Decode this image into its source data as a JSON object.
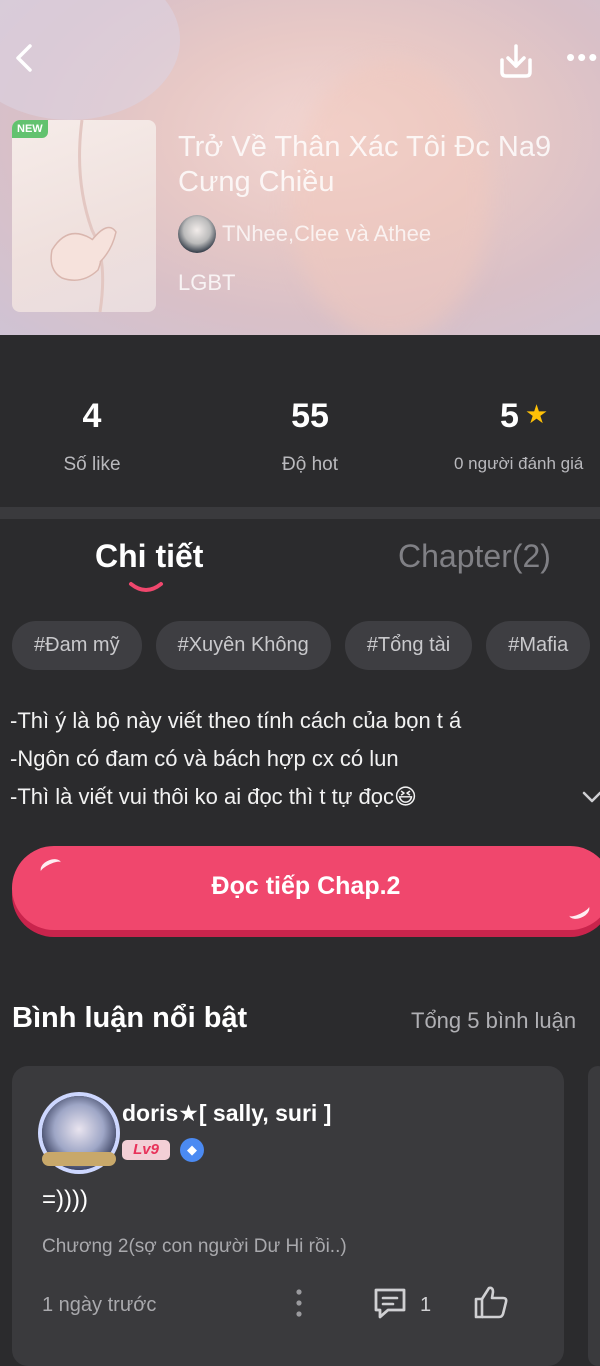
{
  "header": {
    "badge": "NEW",
    "title": "Trở Về Thân Xác Tôi Đc Na9 Cưng Chiều",
    "authors": "TNhee,Clee và Athee",
    "genre": "LGBT"
  },
  "stats": [
    {
      "value": "4",
      "label": "Số like"
    },
    {
      "value": "55",
      "label": "Độ hot"
    },
    {
      "value": "5",
      "label": "0 người đánh giá"
    }
  ],
  "tabs": [
    {
      "label": "Chi tiết",
      "active": true
    },
    {
      "label": "Chapter(2)",
      "active": false
    }
  ],
  "tags": [
    "#Đam mỹ",
    "#Xuyên Không",
    "#Tổng tài",
    "#Mafia"
  ],
  "description": [
    "-Thì ý là bộ này viết theo tính cách của bọn t á",
    "-Ngôn có đam có và bách hợp cx có lun",
    "-Thì là viết vui thôi ko ai đọc thì t tự đọc😆"
  ],
  "read_button": "Đọc tiếp Chap.2",
  "comments_section": {
    "title": "Bình luận nổi bật",
    "count": "Tổng 5 bình luận"
  },
  "comment": {
    "user": "doris★[ sally, suri ]",
    "level": "Lv9",
    "text": "=))))",
    "chapter": "Chương 2(sợ con người Dư Hi rồi..)",
    "time": "1 ngày trước",
    "reply_count": "1"
  },
  "colors": {
    "background": "#2b2b2d",
    "accent": "#f0476d",
    "star": "#ffc107",
    "tag_bg": "#3e3e42"
  }
}
